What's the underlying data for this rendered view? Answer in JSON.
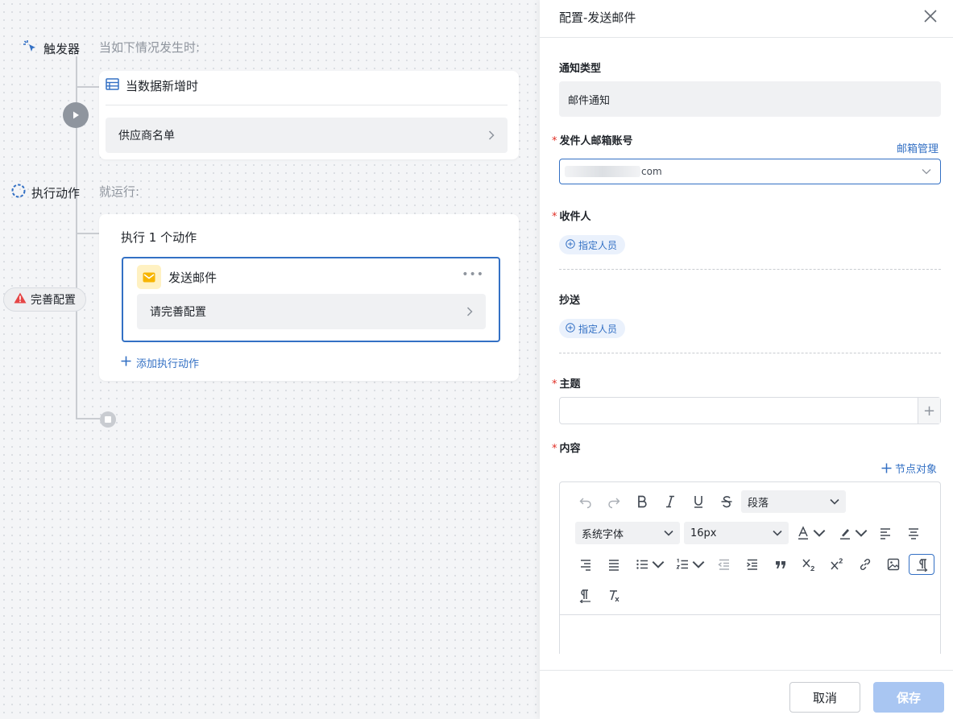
{
  "flow": {
    "trigger_label": "触发器",
    "trigger_sub": "当如下情况发生时:",
    "trigger_card_title": "当数据新增时",
    "trigger_source": "供应商名单",
    "action_label": "执行动作",
    "action_sub": "就运行:",
    "action_count_title": "执行 1 个动作",
    "mail_action_title": "发送邮件",
    "mail_action_hint": "请完善配置",
    "add_action": "添加执行动作",
    "warning_badge": "完善配置"
  },
  "panel": {
    "title": "配置-发送邮件",
    "notify_type_label": "通知类型",
    "notify_type_value": "邮件通知",
    "sender_label": "发件人邮箱账号",
    "mailbox_manage": "邮箱管理",
    "sender_value_suffix": "com",
    "recipient_label": "收件人",
    "assign_person": "指定人员",
    "cc_label": "抄送",
    "cc_assign_person": "指定人员",
    "subject_label": "主题",
    "content_label": "内容",
    "node_object": "节点对象",
    "required_mark": "*",
    "editor": {
      "paragraph_select": "段落",
      "font_select": "系统字体",
      "size_select": "16px"
    },
    "cancel": "取消",
    "save": "保存"
  },
  "colors": {
    "accent": "#3370c4",
    "required": "#e02e24",
    "warning": "#e54545",
    "mail_icon": "#f7b500"
  }
}
